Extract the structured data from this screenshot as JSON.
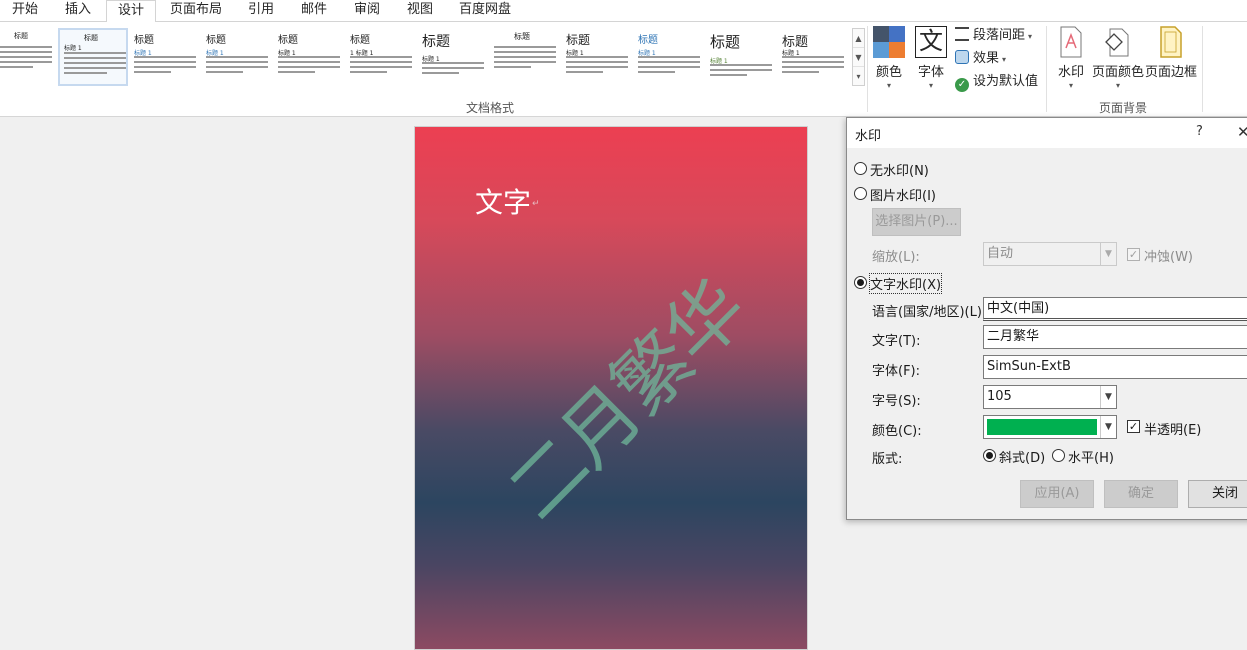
{
  "tabs": [
    "开始",
    "插入",
    "设计",
    "页面布局",
    "引用",
    "邮件",
    "审阅",
    "视图",
    "百度网盘"
  ],
  "active_tab": "设计",
  "ribbon": {
    "gallery_titles": [
      "标题",
      "标题",
      "标题",
      "标题",
      "标题",
      "标题",
      "标题",
      "标题",
      "标题",
      "标题",
      "标题",
      "标题"
    ],
    "gallery_subtitles": [
      "",
      "标题 1",
      "标题 1",
      "标题 1",
      "标题 1",
      "1 标题 1",
      "标题 1",
      "",
      "标题 1",
      "标题 1",
      "标题 1",
      "标题 1"
    ],
    "document_format_label": "文档格式",
    "colors_label": "颜色",
    "fonts_label": "字体",
    "font_glyph": "文",
    "paragraph_spacing_label": "段落间距",
    "effects_label": "效果",
    "set_default_label": "设为默认值",
    "watermark_label": "水印",
    "page_color_label": "页面颜色",
    "page_border_label": "页面边框",
    "page_background_label": "页面背景"
  },
  "document": {
    "text": "文字",
    "watermark_text": "二月繁华"
  },
  "dialog": {
    "title": "水印",
    "help": "?",
    "close_glyph": "✕",
    "no_watermark": "无水印(N)",
    "picture_watermark": "图片水印(I)",
    "select_picture": "选择图片(P)...",
    "scale_label": "缩放(L):",
    "scale_value": "自动",
    "washout": "冲蚀(W)",
    "text_watermark": "文字水印(X)",
    "language_label": "语言(国家/地区)(L):",
    "language_value": "中文(中国)",
    "text_label": "文字(T):",
    "text_value": "二月繁华",
    "font_label": "字体(F):",
    "font_value": "SimSun-ExtB",
    "size_label": "字号(S):",
    "size_value": "105",
    "color_label": "颜色(C):",
    "color_value": "#00b050",
    "semitransparent": "半透明(E)",
    "layout_label": "版式:",
    "diagonal": "斜式(D)",
    "horizontal": "水平(H)",
    "apply": "应用(A)",
    "ok": "确定",
    "close": "关闭"
  },
  "colors": {
    "accent_blue": "#2e74b5",
    "page_top": "#ec3f52",
    "page_mid": "#2c4560",
    "watermark": "#6fb89a"
  }
}
